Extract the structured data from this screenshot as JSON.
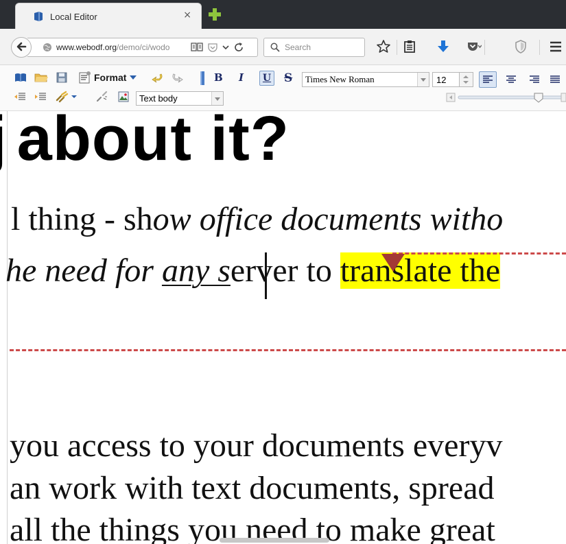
{
  "browser": {
    "tab": {
      "title": "Local Editor",
      "close_glyph": "×"
    },
    "url": {
      "domain": "www.webodf.org",
      "path": "/demo/ci/wodo"
    },
    "search": {
      "placeholder": "Search"
    }
  },
  "toolbar": {
    "format_label": "Format",
    "bold_label": "B",
    "italic_label": "I",
    "underline_label": "U",
    "strike_label": "S",
    "font_family": "Times New Roman",
    "font_size": "12",
    "paragraph_style": "Text body"
  },
  "document": {
    "heading": "about it?",
    "line1_plain": "l thing - sh",
    "line1_italic": "ow office documents witho",
    "line2_italic_a": "he need for ",
    "line2_underlined": "any s",
    "line2_plain": "erver to ",
    "line2_highlight": "translate the",
    "line3": "you access to your documents everyv",
    "line4": "an work with text documents, spread",
    "line5": "all the things you need to make great"
  },
  "colors": {
    "highlight": "#ffff00",
    "annotation": "#a33a35",
    "tab_strip": "#2b2e33",
    "download_arrow": "#1f74d6"
  }
}
